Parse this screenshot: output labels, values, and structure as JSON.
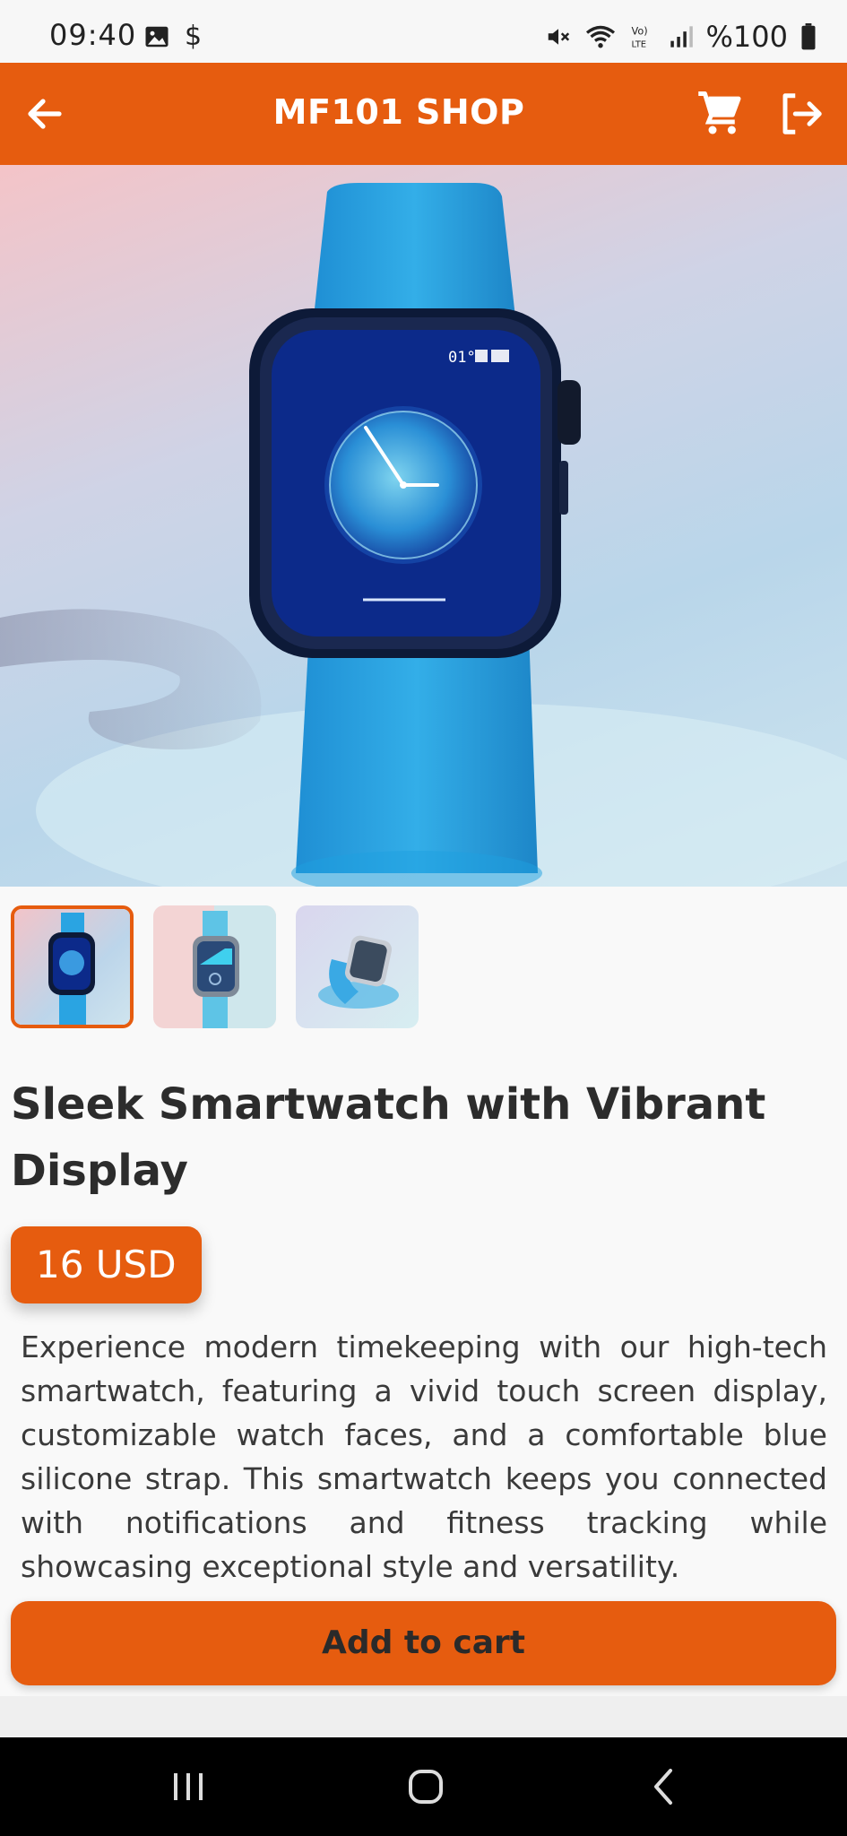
{
  "status": {
    "time": "09:40",
    "battery_text": "%100",
    "icons": [
      "gallery-icon",
      "dollar-icon",
      "mute-icon",
      "wifi-icon",
      "volte-icon",
      "signal-icon",
      "battery-icon"
    ]
  },
  "app_bar": {
    "title": "MF101 SHOP",
    "icons": [
      "back-arrow-icon",
      "cart-icon",
      "logout-icon"
    ]
  },
  "watch_face": {
    "corner_text": "01°"
  },
  "product": {
    "title": "Sleek Smartwatch with Vibrant Display",
    "price": "16 USD",
    "description": "Experience modern timekeeping with our high-tech smartwatch, featuring a vivid touch screen display, customizable watch faces, and a comfortable blue silicone strap. This smartwatch keeps you connected with notifications and fitness tracking while showcasing exceptional style and versatility.",
    "thumbnails_count": 3,
    "selected_thumbnail": 1
  },
  "actions": {
    "add_to_cart": "Add to cart"
  },
  "colors": {
    "accent": "#e65c0f",
    "text_dark": "#2c2c2c",
    "background": "#f9f9f9"
  }
}
